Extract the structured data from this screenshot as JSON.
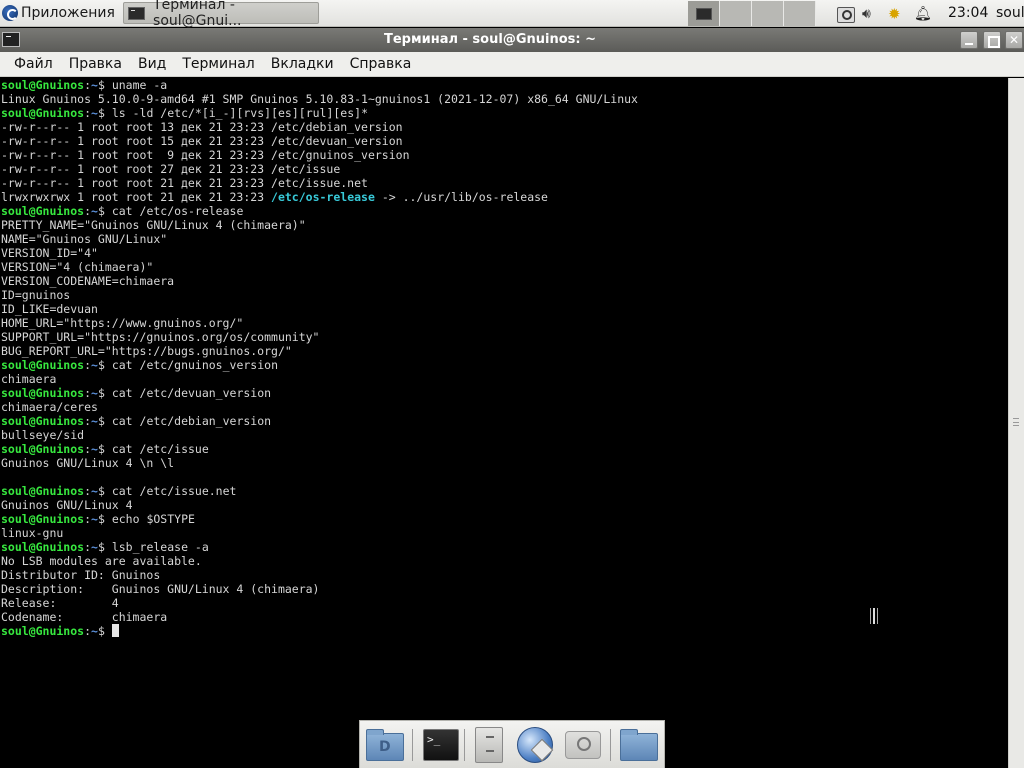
{
  "top_panel": {
    "apps_menu_label": "Приложения",
    "taskbar_item_label": "Терминал - soul@Gnui...",
    "clock": "23:04",
    "user": "soul"
  },
  "window": {
    "title": "Терминал - soul@Gnuinos: ~"
  },
  "menu": {
    "items": [
      "Файл",
      "Правка",
      "Вид",
      "Терминал",
      "Вкладки",
      "Справка"
    ]
  },
  "terminal": {
    "prompt_user": "soul@Gnuinos",
    "prompt_sep": ":",
    "prompt_path": "~",
    "prompt_symbol": "$ ",
    "lines": [
      {
        "type": "cmd",
        "text": "uname -a"
      },
      {
        "type": "out",
        "text": "Linux Gnuinos 5.10.0-9-amd64 #1 SMP Gnuinos 5.10.83-1~gnuinos1 (2021-12-07) x86_64 GNU/Linux"
      },
      {
        "type": "cmd",
        "text": "ls -ld /etc/*[i_-][rvs][es][rul][es]*"
      },
      {
        "type": "out",
        "text": "-rw-r--r-- 1 root root 13 дек 21 23:23 /etc/debian_version"
      },
      {
        "type": "out",
        "text": "-rw-r--r-- 1 root root 15 дек 21 23:23 /etc/devuan_version"
      },
      {
        "type": "out",
        "text": "-rw-r--r-- 1 root root  9 дек 21 23:23 /etc/gnuinos_version"
      },
      {
        "type": "out",
        "text": "-rw-r--r-- 1 root root 27 дек 21 23:23 /etc/issue"
      },
      {
        "type": "out",
        "text": "-rw-r--r-- 1 root root 21 дек 21 23:23 /etc/issue.net"
      },
      {
        "type": "link",
        "prefix": "lrwxrwxrwx 1 root root 21 дек 21 23:23 ",
        "name": "/etc/os-release",
        "suffix": " -> ../usr/lib/os-release"
      },
      {
        "type": "cmd",
        "text": "cat /etc/os-release"
      },
      {
        "type": "out",
        "text": "PRETTY_NAME=\"Gnuinos GNU/Linux 4 (chimaera)\""
      },
      {
        "type": "out",
        "text": "NAME=\"Gnuinos GNU/Linux\""
      },
      {
        "type": "out",
        "text": "VERSION_ID=\"4\""
      },
      {
        "type": "out",
        "text": "VERSION=\"4 (chimaera)\""
      },
      {
        "type": "out",
        "text": "VERSION_CODENAME=chimaera"
      },
      {
        "type": "out",
        "text": "ID=gnuinos"
      },
      {
        "type": "out",
        "text": "ID_LIKE=devuan"
      },
      {
        "type": "out",
        "text": "HOME_URL=\"https://www.gnuinos.org/\""
      },
      {
        "type": "out",
        "text": "SUPPORT_URL=\"https://gnuinos.org/os/community\""
      },
      {
        "type": "out",
        "text": "BUG_REPORT_URL=\"https://bugs.gnuinos.org/\""
      },
      {
        "type": "cmd",
        "text": "cat /etc/gnuinos_version"
      },
      {
        "type": "out",
        "text": "chimaera"
      },
      {
        "type": "cmd",
        "text": "cat /etc/devuan_version"
      },
      {
        "type": "out",
        "text": "chimaera/ceres"
      },
      {
        "type": "cmd",
        "text": "cat /etc/debian_version"
      },
      {
        "type": "out",
        "text": "bullseye/sid"
      },
      {
        "type": "cmd",
        "text": "cat /etc/issue"
      },
      {
        "type": "out",
        "text": "Gnuinos GNU/Linux 4 \\n \\l"
      },
      {
        "type": "out",
        "text": ""
      },
      {
        "type": "cmd",
        "text": "cat /etc/issue.net"
      },
      {
        "type": "out",
        "text": "Gnuinos GNU/Linux 4"
      },
      {
        "type": "cmd",
        "text": "echo $OSTYPE"
      },
      {
        "type": "out",
        "text": "linux-gnu"
      },
      {
        "type": "cmd",
        "text": "lsb_release -a"
      },
      {
        "type": "out",
        "text": "No LSB modules are available."
      },
      {
        "type": "out",
        "text": "Distributor ID: Gnuinos"
      },
      {
        "type": "out",
        "text": "Description:    Gnuinos GNU/Linux 4 (chimaera)"
      },
      {
        "type": "out",
        "text": "Release:        4"
      },
      {
        "type": "out",
        "text": "Codename:       chimaera"
      },
      {
        "type": "cursor",
        "text": ""
      }
    ]
  },
  "dock": {
    "items": [
      "file-manager-icon",
      "terminal-icon",
      "file-cabinet-icon",
      "web-browser-icon",
      "search-icon",
      "folder-icon"
    ],
    "terminal_glyph": ">_"
  },
  "colors": {
    "prompt_user": "#37e83f",
    "prompt_path": "#5a8ed6",
    "symlink": "#38c9d8",
    "terminal_bg": "#000000",
    "terminal_fg": "#d6d6d6"
  }
}
